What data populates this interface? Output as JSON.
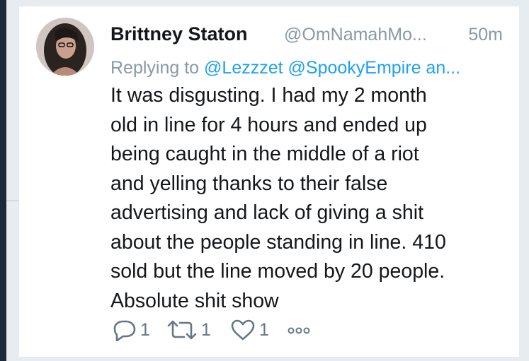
{
  "tweet": {
    "author_name": "Brittney Staton",
    "author_handle": "@OmNamahMo...",
    "time_ago": "50m",
    "reply_prefix": "Replying to",
    "reply_mention_1": "@Lezzzet",
    "reply_mention_2": "@SpookyEmpire an...",
    "body_lines": [
      "It was disgusting. I had my 2 month",
      "old in line for 4 hours and ended up",
      "being caught in the middle of a riot",
      "and yelling thanks to their false",
      "advertising and lack of giving a shit",
      "about the people standing in line. 410",
      "sold but the line moved by 20 people.",
      "Absolute shit show"
    ],
    "actions": {
      "reply_count": "1",
      "retweet_count": "1",
      "like_count": "1"
    }
  },
  "icons": {
    "reply": "reply-icon",
    "retweet": "retweet-icon",
    "like": "heart-icon",
    "more": "more-dots-icon"
  },
  "colors": {
    "text_primary": "#14171a",
    "text_secondary": "#8899a6",
    "link": "#1da1f2",
    "icon": "#657786",
    "background": "#e6ecf0",
    "card": "#ffffff"
  }
}
